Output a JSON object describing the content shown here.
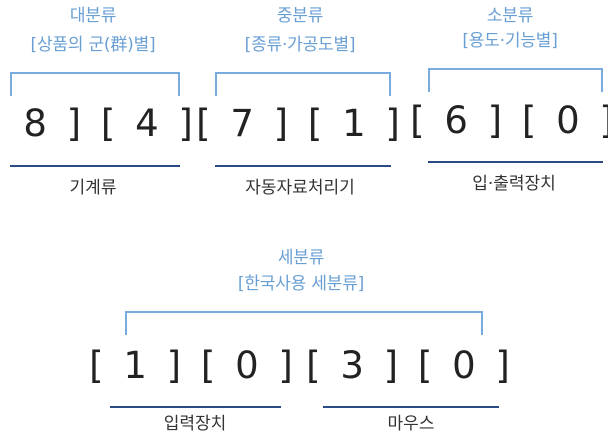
{
  "major": {
    "title": "대분류",
    "subtitle": "[상품의 군(群)별]",
    "code": "[ 8 ] [ 4 ]",
    "name": "기계류"
  },
  "middle": {
    "title": "중분류",
    "subtitle": "[종류·가공도별]",
    "code": "[ 7 ] [ 1 ]",
    "name": "자동자료처리기"
  },
  "minor": {
    "title": "소분류",
    "subtitle": "[용도·기능별]",
    "code": "[ 6 ] [ 0 ]",
    "name": "입·출력장치"
  },
  "detail": {
    "title": "세분류",
    "subtitle": "[한국사용 세분류]",
    "code_left": "[ 1 ] [ 0 ]",
    "name_left": "입력장치",
    "code_right": "[ 3 ] [ 0 ]",
    "name_right": "마우스"
  },
  "colors": {
    "label_blue": "#6a9fd4",
    "bracket_blue": "#79acdc",
    "underline_navy": "#2c4a86",
    "text_dark": "#222222"
  }
}
